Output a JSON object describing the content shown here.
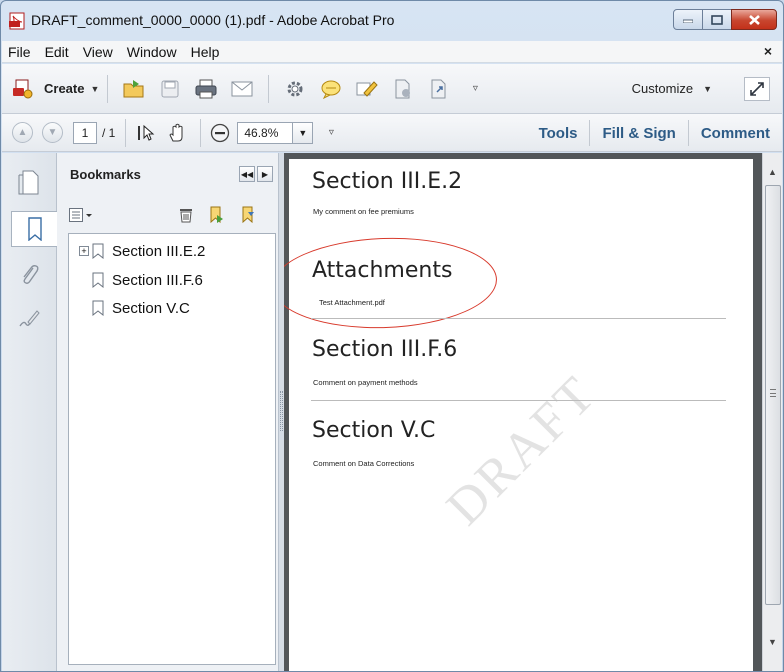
{
  "window": {
    "title": "DRAFT_comment_0000_0000 (1).pdf - Adobe Acrobat Pro",
    "controls": [
      "minimize",
      "maximize",
      "close"
    ]
  },
  "menu": {
    "items": [
      "File",
      "Edit",
      "View",
      "Window",
      "Help"
    ],
    "close_glyph": "×"
  },
  "toolbar": {
    "create_label": "Create",
    "customize_label": "Customize",
    "icons": [
      "create-pdf-icon",
      "open-folder-icon",
      "save-icon",
      "print-icon",
      "email-icon",
      "settings-gear-icon",
      "comment-bubble-icon",
      "highlight-pen-icon",
      "redact-icon",
      "export-icon",
      "more-icon",
      "expand-icon"
    ]
  },
  "navbar": {
    "page_current": "1",
    "page_total": "/ 1",
    "zoom": "46.8%",
    "tools_label": "Tools",
    "fill_sign_label": "Fill & Sign",
    "comment_label": "Comment"
  },
  "bookmarks": {
    "title": "Bookmarks",
    "items": [
      {
        "label": "Section III.E.2",
        "expandable": true
      },
      {
        "label": "Section III.F.6",
        "expandable": false
      },
      {
        "label": "Section V.C",
        "expandable": false
      }
    ]
  },
  "document": {
    "watermark": "DRAFT",
    "sections": [
      {
        "heading": "Section III.E.2",
        "comment": "My comment on fee premiums"
      },
      {
        "heading": "Attachments",
        "comment": "Test Attachment.pdf"
      },
      {
        "heading": "Section III.F.6",
        "comment": "Comment on payment methods"
      },
      {
        "heading": "Section V.C",
        "comment": "Comment on Data Corrections"
      }
    ],
    "highlight_color": "#d83a2c"
  }
}
